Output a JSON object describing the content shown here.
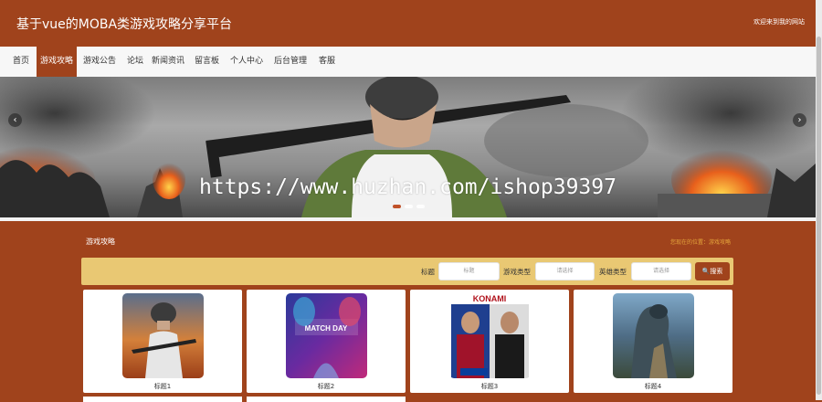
{
  "header": {
    "site_title": "基于vue的MOBA类游戏攻略分享平台",
    "welcome_text": "欢迎来到我的网站"
  },
  "nav": {
    "items": [
      {
        "label": "首页"
      },
      {
        "label": "游戏攻略",
        "active": true
      },
      {
        "label": "游戏公告"
      },
      {
        "label": "论坛"
      },
      {
        "label": "新闻资讯"
      },
      {
        "label": "留言板"
      },
      {
        "label": "个人中心"
      },
      {
        "label": "后台管理"
      },
      {
        "label": "客服"
      }
    ]
  },
  "banner": {
    "watermark": "https://www.huzhan.com/ishop39397",
    "prev_icon": "‹",
    "next_icon": "›",
    "slide_count": 3,
    "active_slide": 0
  },
  "section": {
    "title": "游戏攻略",
    "breadcrumb": "您现在的位置：游戏攻略"
  },
  "search": {
    "title_label": "标题",
    "title_placeholder": "标题",
    "type_label": "游戏类型",
    "type_value": "请选择",
    "hero_label": "英雄类型",
    "hero_value": "请选择",
    "button_label": "搜索"
  },
  "cards": [
    {
      "title": "标题1"
    },
    {
      "title": "标题2"
    },
    {
      "title": "标题3"
    },
    {
      "title": "标题4"
    }
  ],
  "colors": {
    "brand": "#a0431c",
    "search_bar": "#e9c873",
    "breadcrumb": "#e6a73d"
  }
}
